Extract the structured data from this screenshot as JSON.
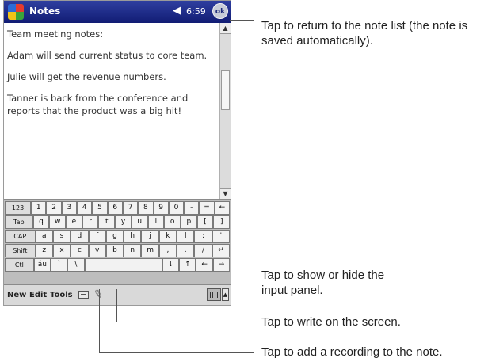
{
  "device": {
    "app_title": "Notes",
    "clock": "6:59",
    "ok_label": "ok",
    "note_lines": [
      "Team meeting notes:",
      "Adam will send current status to core team.",
      "Julie will get the revenue numbers.",
      "Tanner is back from the conference and reports that the product was a big hit!"
    ],
    "keyboard": {
      "rows": [
        [
          "123",
          "1",
          "2",
          "3",
          "4",
          "5",
          "6",
          "7",
          "8",
          "9",
          "0",
          "-",
          "=",
          "←"
        ],
        [
          "Tab",
          "q",
          "w",
          "e",
          "r",
          "t",
          "y",
          "u",
          "i",
          "o",
          "p",
          "[",
          "]"
        ],
        [
          "CAP",
          "a",
          "s",
          "d",
          "f",
          "g",
          "h",
          "j",
          "k",
          "l",
          ";",
          "'"
        ],
        [
          "Shift",
          "z",
          "x",
          "c",
          "v",
          "b",
          "n",
          "m",
          ",",
          ".",
          "/",
          "↵"
        ],
        [
          "Ctl",
          "áü",
          "`",
          "\\",
          " ",
          "↓",
          "↑",
          "←",
          "→"
        ]
      ]
    },
    "menu": {
      "new": "New",
      "edit": "Edit",
      "tools": "Tools"
    }
  },
  "callouts": {
    "ok_button": "Tap to return to the note  list (the note is saved automatically).",
    "input_panel": "Tap to show or hide the input panel.",
    "pen": "Tap to write on the screen.",
    "recording": "Tap to add a recording to the note."
  }
}
